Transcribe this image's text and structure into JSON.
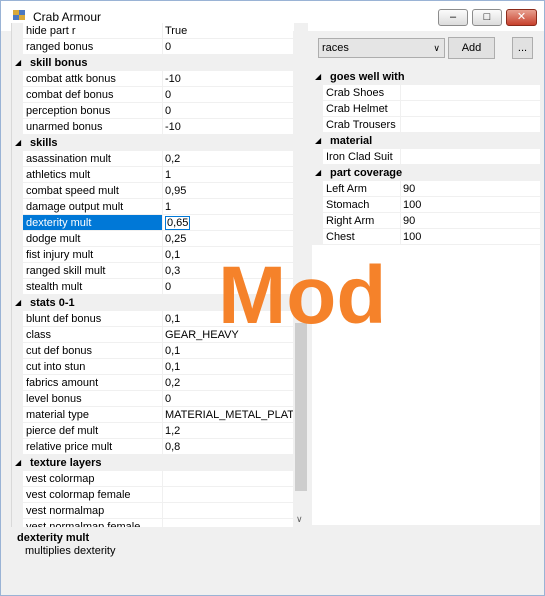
{
  "window": {
    "title": "Crab Armour"
  },
  "titlebar": {
    "min_glyph": "–",
    "max_glyph": "□",
    "close_glyph": "✕"
  },
  "left_grid": {
    "rows": [
      {
        "type": "prop",
        "name": "hide part r",
        "value": "True"
      },
      {
        "type": "prop",
        "name": "ranged bonus",
        "value": "0"
      },
      {
        "type": "cat",
        "name": "skill bonus"
      },
      {
        "type": "prop",
        "name": "combat attk bonus",
        "value": "-10"
      },
      {
        "type": "prop",
        "name": "combat def bonus",
        "value": "0"
      },
      {
        "type": "prop",
        "name": "perception bonus",
        "value": "0"
      },
      {
        "type": "prop",
        "name": "unarmed bonus",
        "value": "-10"
      },
      {
        "type": "cat",
        "name": "skills"
      },
      {
        "type": "prop",
        "name": "asassination mult",
        "value": "0,2"
      },
      {
        "type": "prop",
        "name": "athletics mult",
        "value": "1"
      },
      {
        "type": "prop",
        "name": "combat speed mult",
        "value": "0,95"
      },
      {
        "type": "prop",
        "name": "damage output mult",
        "value": "1"
      },
      {
        "type": "prop",
        "name": "dexterity mult",
        "value": "0,65",
        "selected": true
      },
      {
        "type": "prop",
        "name": "dodge mult",
        "value": "0,25"
      },
      {
        "type": "prop",
        "name": "fist injury mult",
        "value": "0,1"
      },
      {
        "type": "prop",
        "name": "ranged skill mult",
        "value": "0,3"
      },
      {
        "type": "prop",
        "name": "stealth mult",
        "value": "0"
      },
      {
        "type": "cat",
        "name": "stats 0-1"
      },
      {
        "type": "prop",
        "name": "blunt def bonus",
        "value": "0,1"
      },
      {
        "type": "prop",
        "name": "class",
        "value": "GEAR_HEAVY"
      },
      {
        "type": "prop",
        "name": "cut def bonus",
        "value": "0,1"
      },
      {
        "type": "prop",
        "name": "cut into stun",
        "value": "0,1"
      },
      {
        "type": "prop",
        "name": "fabrics amount",
        "value": "0,2"
      },
      {
        "type": "prop",
        "name": "level bonus",
        "value": "0"
      },
      {
        "type": "prop",
        "name": "material type",
        "value": "MATERIAL_METAL_PLATE"
      },
      {
        "type": "prop",
        "name": "pierce def mult",
        "value": "1,2"
      },
      {
        "type": "prop",
        "name": "relative price mult",
        "value": "0,8"
      },
      {
        "type": "cat",
        "name": "texture layers"
      },
      {
        "type": "prop",
        "name": "vest colormap",
        "value": ""
      },
      {
        "type": "prop",
        "name": "vest colormap female",
        "value": ""
      },
      {
        "type": "prop",
        "name": "vest normalmap",
        "value": ""
      },
      {
        "type": "prop",
        "name": "vest normalmap female",
        "value": ""
      }
    ]
  },
  "right_panel": {
    "combo_value": "races",
    "add_label": "Add",
    "more_label": "...",
    "rows": [
      {
        "type": "cat",
        "name": "goes well with"
      },
      {
        "type": "prop",
        "name": "Crab Shoes",
        "value": ""
      },
      {
        "type": "prop",
        "name": "Crab Helmet",
        "value": ""
      },
      {
        "type": "prop",
        "name": "Crab Trousers",
        "value": ""
      },
      {
        "type": "cat",
        "name": "material"
      },
      {
        "type": "prop",
        "name": "Iron Clad Suit",
        "value": ""
      },
      {
        "type": "cat",
        "name": "part coverage"
      },
      {
        "type": "prop",
        "name": "Left Arm",
        "value": "90"
      },
      {
        "type": "prop",
        "name": "Stomach",
        "value": "100"
      },
      {
        "type": "prop",
        "name": "Right Arm",
        "value": "90"
      },
      {
        "type": "prop",
        "name": "Chest",
        "value": "100"
      }
    ]
  },
  "description": {
    "title": "dexterity mult",
    "text": "multiplies dexterity"
  },
  "watermark": "Mod",
  "colors": {
    "selection": "#0078d7",
    "watermark": "#f5822a",
    "category_bg": "#f0f0f0"
  }
}
